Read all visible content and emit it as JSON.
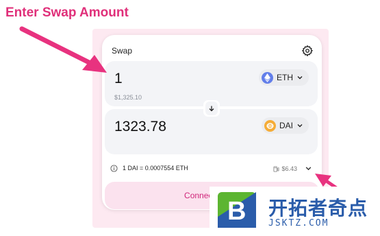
{
  "annotation": {
    "title": "Enter Swap Amount"
  },
  "swap": {
    "title": "Swap",
    "settings_icon": "gear-icon",
    "from": {
      "amount": "1",
      "usd_value": "$1,325.10",
      "token": "ETH",
      "token_color": "#627eea"
    },
    "to": {
      "amount": "1323.78",
      "token": "DAI",
      "token_color": "#f5ac37"
    },
    "rate": "1 DAI = 0.0007554 ETH",
    "gas_fee": "$6.43",
    "connect_label": "Connect Wallet"
  },
  "watermark": {
    "chinese": "开拓者奇点",
    "domain": "JSKTZ.COM",
    "logo_letter": "B"
  },
  "colors": {
    "accent": "#e0307a",
    "connect_bg": "#fbe2ee",
    "connect_text": "#d0267a",
    "watermark_blue": "#2a5caa",
    "watermark_green": "#5cb531"
  }
}
